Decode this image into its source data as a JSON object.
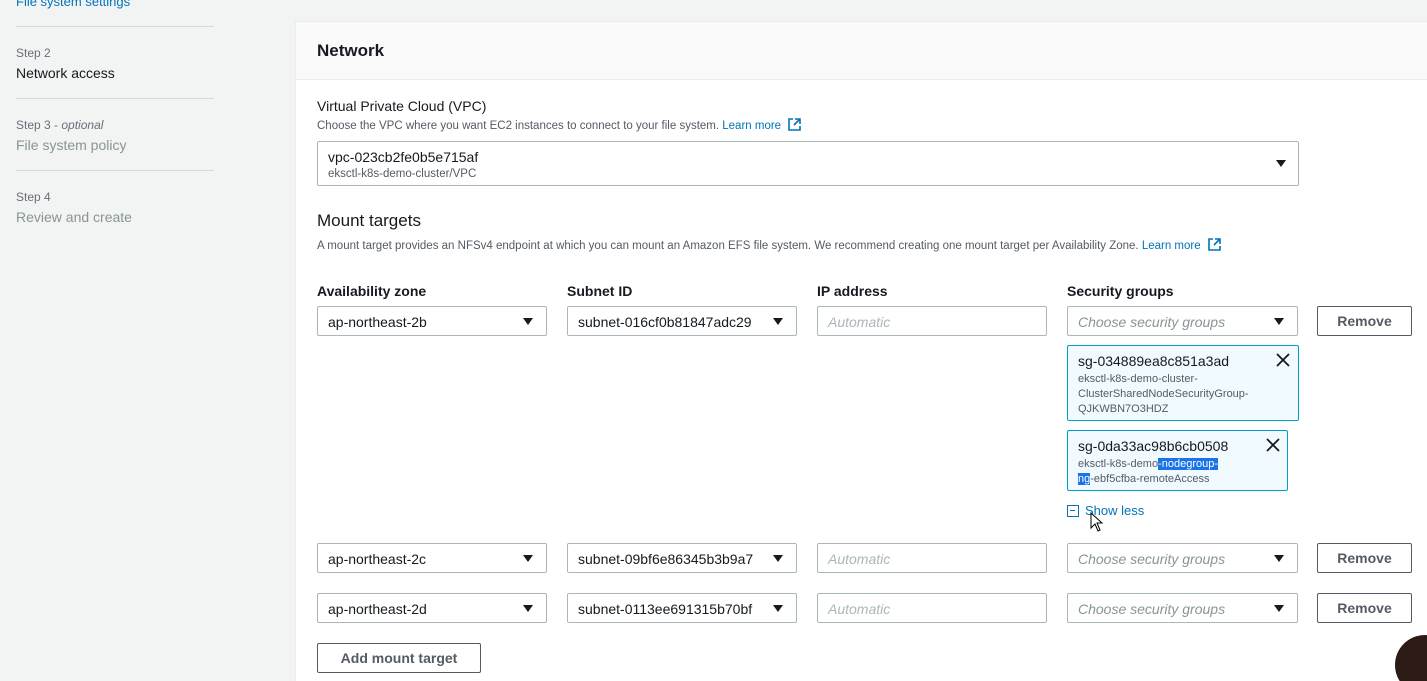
{
  "sidebar": {
    "top_link": "File system settings",
    "steps": [
      {
        "label": "Step 2",
        "title": "Network access"
      },
      {
        "label": "Step 3",
        "optional": "optional",
        "title": "File system policy"
      },
      {
        "label": "Step 4",
        "title": "Review and create"
      }
    ]
  },
  "network": {
    "title": "Network",
    "vpc": {
      "label": "Virtual Private Cloud (VPC)",
      "description": "Choose the VPC where you want EC2 instances to connect to your file system.",
      "learn_more": "Learn more",
      "selected_id": "vpc-023cb2fe0b5e715af",
      "selected_name": "eksctl-k8s-demo-cluster/VPC"
    },
    "mount_targets": {
      "title": "Mount targets",
      "description": "A mount target provides an NFSv4 endpoint at which you can mount an Amazon EFS file system. We recommend creating one mount target per Availability Zone.",
      "learn_more": "Learn more",
      "columns": {
        "az": "Availability zone",
        "subnet": "Subnet ID",
        "ip": "IP address",
        "sg": "Security groups"
      },
      "ip_placeholder": "Automatic",
      "sg_placeholder": "Choose security groups",
      "remove_label": "Remove",
      "rows": [
        {
          "az": "ap-northeast-2b",
          "subnet": "subnet-016cf0b81847adc29"
        },
        {
          "az": "ap-northeast-2c",
          "subnet": "subnet-09bf6e86345b3b9a7"
        },
        {
          "az": "ap-northeast-2d",
          "subnet": "subnet-0113ee691315b70bf"
        }
      ],
      "selected_groups": [
        {
          "id": "sg-034889ea8c851a3ad",
          "desc_1": "eksctl-k8s-demo-cluster-",
          "desc_2": "ClusterSharedNodeSecurityGroup-",
          "desc_3": "QJKWBN7O3HDZ"
        },
        {
          "id": "sg-0da33ac98b6cb0508",
          "desc_1a": "eksctl-k8s-demo",
          "desc_1b": "-nodegroup-",
          "desc_2a": "ng",
          "desc_2b": "-ebf5cfba-remoteAccess"
        }
      ],
      "show_less": "Show less",
      "add_button": "Add mount target"
    }
  },
  "colors": {
    "link": "#0073bb",
    "token_border": "#00a1c9",
    "highlight": "#1a73e8"
  }
}
